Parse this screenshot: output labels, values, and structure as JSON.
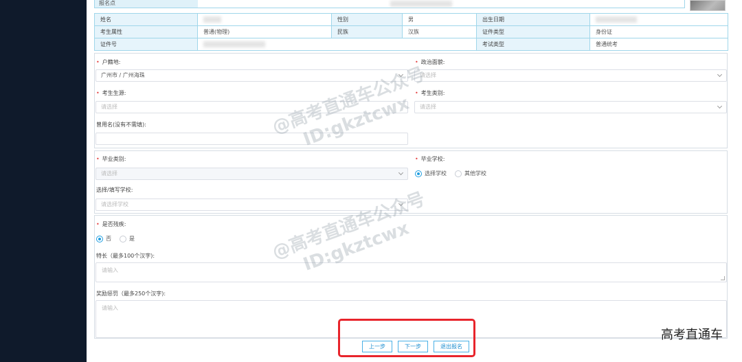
{
  "header": {
    "registration_label": "报名点"
  },
  "info": {
    "r1": {
      "name_label": "姓名",
      "gender_label": "性别",
      "gender_value": "男",
      "birth_label": "出生日期"
    },
    "r2": {
      "attr_label": "考生属性",
      "attr_value": "普通(物理)",
      "ethnic_label": "民族",
      "ethnic_value": "汉族",
      "idtype_label": "证件类型",
      "idtype_value": "身份证"
    },
    "r3": {
      "idno_label": "证件号",
      "examtype_label": "考试类型",
      "examtype_value": "普通统考"
    }
  },
  "form1": {
    "hukou_label": "户籍地:",
    "hukou_value": "广州市 / 广州海珠",
    "politics_label": "政治面貌:",
    "politics_placeholder": "请选择",
    "source_label": "考生生源:",
    "source_placeholder": "请选择",
    "category_label": "考生类别:",
    "category_placeholder": "请选择",
    "former_name_label": "曾用名(没有不需填):"
  },
  "form2": {
    "grad_type_label": "毕业类别:",
    "grad_type_placeholder": "请选择",
    "grad_school_label": "毕业学校:",
    "opt_select_school": "选择学校",
    "opt_other_school": "其他学校",
    "choose_school_label": "选择/填写学校:",
    "choose_school_placeholder": "请选择学校"
  },
  "form3": {
    "disabled_label": "是否残疾:",
    "opt_no": "否",
    "opt_yes": "是",
    "specialty_label": "特长（最多100个汉字):",
    "specialty_placeholder": "请输入",
    "awards_label": "奖励惩罚（最多250个汉字):",
    "awards_placeholder": "请输入"
  },
  "buttons": {
    "prev": "上一步",
    "next": "下一步",
    "exit": "退出报名"
  },
  "watermark": {
    "line1": "@高考直通车公众号",
    "line2": "ID:gkztcwx"
  },
  "corner_mark": "高考直通车",
  "colors": {
    "sidebar": "#0f1a2b",
    "accent": "#1f9ee0",
    "border": "#9fd6ea",
    "highlight": "#e8242b"
  }
}
